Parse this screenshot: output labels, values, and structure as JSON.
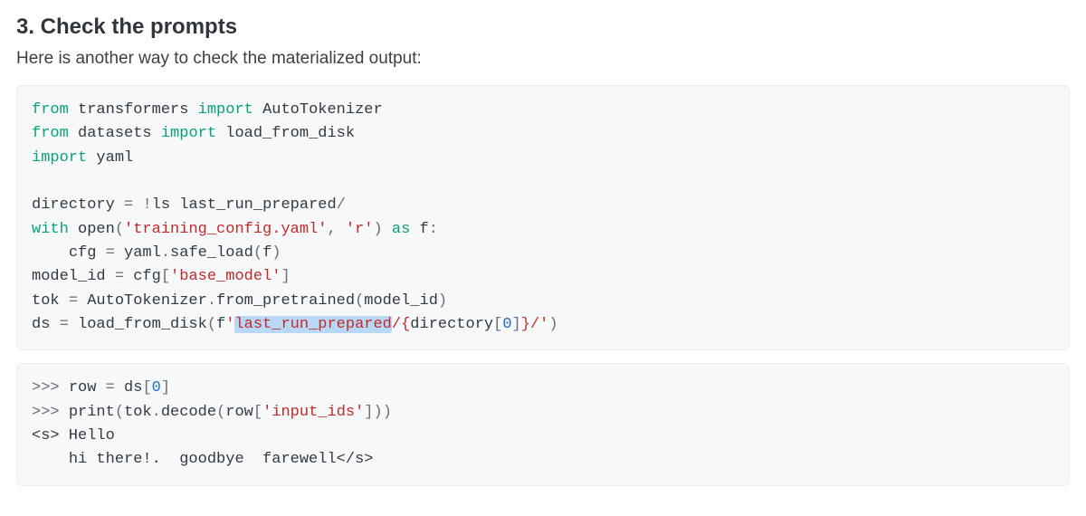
{
  "heading": "3. Check the prompts",
  "intro": "Here is another way to check the materialized output:",
  "code1": {
    "l1": {
      "kw_from": "from",
      "pkg": "transformers",
      "kw_import": "import",
      "name": "AutoTokenizer"
    },
    "l2": {
      "kw_from": "from",
      "pkg": "datasets",
      "kw_import": "import",
      "name": "load_from_disk"
    },
    "l3": {
      "kw_import": "import",
      "pkg": "yaml"
    },
    "l5": {
      "lhs": "directory",
      "op1": "=",
      "bang": "!",
      "cmd": "ls",
      "path": "last_run_prepared",
      "slash": "/"
    },
    "l6": {
      "kw_with": "with",
      "open": "open",
      "lp": "(",
      "s1": "'training_config.yaml'",
      "comma": ",",
      "s2": "'r'",
      "rp": ")",
      "kw_as": "as",
      "f": "f",
      "colon": ":"
    },
    "l7": {
      "indent": "    ",
      "cfg": "cfg",
      "op": "=",
      "yaml": "yaml",
      "dot": ".",
      "safe_load": "safe_load",
      "lp": "(",
      "f": "f",
      "rp": ")"
    },
    "l8": {
      "lhs": "model_id",
      "op": "=",
      "cfg": "cfg",
      "lb": "[",
      "key": "'base_model'",
      "rb": "]"
    },
    "l9": {
      "lhs": "tok",
      "op": "=",
      "cls": "AutoTokenizer",
      "dot": ".",
      "fn": "from_pretrained",
      "lp": "(",
      "arg": "model_id",
      "rp": ")"
    },
    "l10": {
      "lhs": "ds",
      "op": "=",
      "fn": "load_from_disk",
      "lp": "(",
      "fpfx": "f",
      "q1": "'",
      "sel": "last_run_prepared",
      "mid": "/",
      "lbrace": "{",
      "dir": "directory",
      "lb": "[",
      "zero": "0",
      "rb": "]",
      "rbrace": "}",
      "tail": "/",
      "q2": "'",
      "rp": ")"
    }
  },
  "code2": {
    "l1": {
      "prompt": ">>>",
      "row": "row",
      "op": "=",
      "ds": "ds",
      "lb": "[",
      "idx": "0",
      "rb": "]"
    },
    "l2": {
      "prompt": ">>>",
      "print": "print",
      "lp": "(",
      "tok": "tok",
      "dot": ".",
      "decode": "decode",
      "lp2": "(",
      "row": "row",
      "lb": "[",
      "key": "'input_ids'",
      "rb": "]",
      "rp2": ")",
      "rp": ")"
    },
    "l3": {
      "open_tag_lt": "<",
      "open_tag_s": "s",
      "open_tag_gt": ">",
      "hello": " Hello"
    },
    "l4": {
      "indent": "    ",
      "body": "hi there!.  goodbye  farewell",
      "close_lt": "<",
      "close_slash": "/",
      "close_s": "s",
      "close_gt": ">"
    }
  }
}
